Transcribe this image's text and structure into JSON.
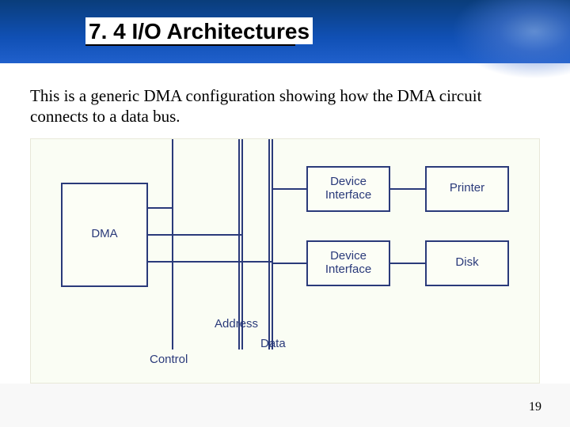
{
  "header": {
    "title": "7. 4 I/O Architectures"
  },
  "content": {
    "intro": "This is a generic DMA configuration showing how the DMA circuit connects to a data bus."
  },
  "diagram": {
    "boxes": {
      "dma": "DMA",
      "device_interface_1": "Device\nInterface",
      "device_interface_2": "Device\nInterface",
      "printer": "Printer",
      "disk": "Disk"
    },
    "bus_labels": {
      "control": "Control",
      "address": "Address",
      "data": "Data"
    }
  },
  "page_number": "19",
  "colors": {
    "header_blue": "#1050b5",
    "box_border": "#2a3a7a",
    "diagram_bg": "#fafdf4"
  }
}
